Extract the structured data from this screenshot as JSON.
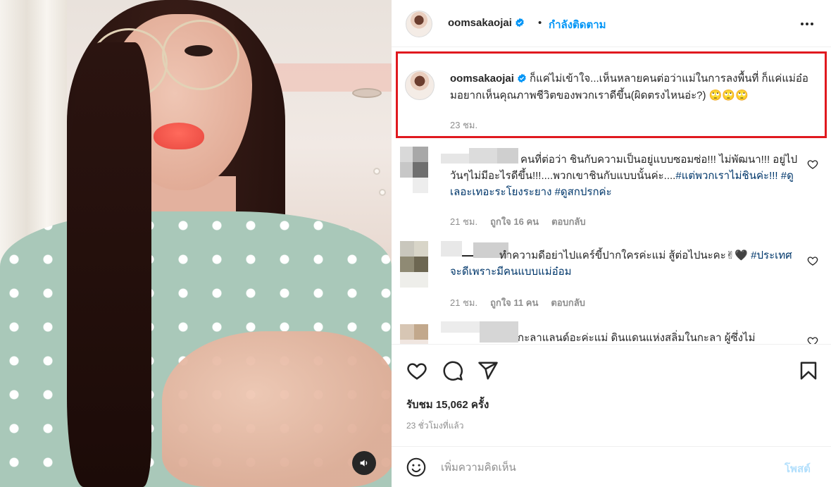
{
  "post": {
    "username": "oomsakaojai",
    "follow_status": "กำลังติดตาม",
    "separator": "•",
    "caption": {
      "username": "oomsakaojai",
      "text": "ก็แค่ไม่เข้าใจ...เห็นหลายคนต่อว่าแม่ในการลงพื้นที่ ก็แค่แม่อ๋อมอยากเห็นคุณภาพชีวิตของพวกเราดีขึ้น(ผิดตรงไหนอ่ะ?) 🙄🙄🙄",
      "time": "23 ชม."
    },
    "comments": [
      {
        "text_plain": "คนที่ต่อว่า ชินกับความเป็นอยู่แบบซอมซ่อ!!! ไม่พัฒนา!!! อยู่ไปวันๆไม่มีอะไรดีขึ้น!!!....พวกเขาชินกับแบบนั้นค่ะ....",
        "tags": "#แต่พวกเราไม่ชินค่ะ!!! #ดูเลอะเทอะระโยงระยาง #ดูสกปรกค่ะ",
        "time": "21 ชม.",
        "likes": "ถูกใจ 16 คน",
        "reply": "ตอบกลับ"
      },
      {
        "text_plain": "ทำความดีอย่าไปแคร์ขี้ปากใครค่ะแม่ สู้ต่อไปนะคะ✌🖤",
        "tags": "#ประเทศจะดีเพราะมีคนแบบแม่อ๋อม",
        "time": "21 ชม.",
        "likes": "ถูกใจ 11 คน",
        "reply": "ตอบกลับ"
      },
      {
        "text_plain": "กะลาแลนด์อะค่ะแม่ ดินแดนแห่งสลิ่มในกะลา ผู้ซึ่งไม่",
        "tags": "",
        "time": "",
        "likes": "",
        "reply": ""
      }
    ],
    "views": "รับชม 15,062 ครั้ง",
    "posted_ago": "23 ชั่วโมงที่แล้ว",
    "add_comment": {
      "placeholder": "เพิ่มความคิดเห็น",
      "post_label": "โพสต์"
    }
  },
  "icons": {
    "verified": "verified-badge-icon",
    "more": "more-options-icon",
    "like": "heart-icon",
    "comment": "comment-icon",
    "share": "paper-plane-icon",
    "save": "bookmark-icon",
    "emoji": "emoji-icon",
    "sound": "speaker-icon"
  },
  "colors": {
    "accent": "#0095f6",
    "highlight_border": "#e0191f",
    "hashtag": "#00376b",
    "muted": "#8e8e8e",
    "post_disabled": "#b2dffc"
  }
}
